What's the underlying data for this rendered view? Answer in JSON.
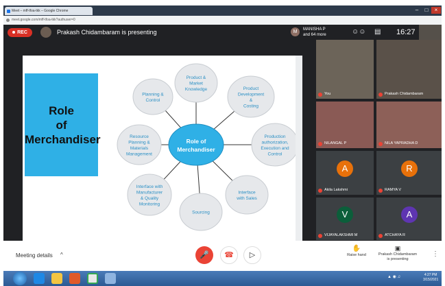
{
  "browser": {
    "tab_title": "Meet – mff-tfoa-tkk – Google Chrome",
    "address": "meet.google.com/mff-tfoa-tkk?authuser=0"
  },
  "topbar": {
    "rec_label": "REC",
    "presenting_text": "Prakash Chidambaram is presenting",
    "participants_name": "MANISHA P",
    "participants_more": "and 64 more",
    "time": "16:27"
  },
  "slide": {
    "title_lines": [
      "Role",
      "of",
      "Merchandiser"
    ],
    "center": [
      "Role of",
      "Merchandiser"
    ],
    "bubbles": [
      [
        "Product &",
        "Market",
        "Knowledge"
      ],
      [
        "Product",
        "Development",
        "&",
        "Costing"
      ],
      [
        "Production",
        "authorization,",
        "Execution and",
        "Control"
      ],
      [
        "Interface",
        "with Sales"
      ],
      [
        "Sourcing"
      ],
      [
        "Interface with",
        "Manufacturer",
        "& Quality",
        "Monitoring"
      ],
      [
        "Resource",
        "Planning &",
        "Materials",
        "Management"
      ],
      [
        "Planning &",
        "Control"
      ]
    ]
  },
  "participants": [
    {
      "name": "You",
      "type": "video"
    },
    {
      "name": "Prakash Chidambaram",
      "type": "video"
    },
    {
      "name": "NILANGAL P",
      "type": "video"
    },
    {
      "name": "NILA YAPRADHA D",
      "type": "video"
    },
    {
      "name": "Akila Lakshmi",
      "type": "avatar",
      "letter": "A",
      "color": "#e8710a"
    },
    {
      "name": "RAMYA V",
      "type": "avatar",
      "letter": "R",
      "color": "#e8710a"
    },
    {
      "name": "VIJAYALAKSHMI M",
      "type": "avatar",
      "letter": "V",
      "color": "#0b5e3a"
    },
    {
      "name": "ATCHAYA R",
      "type": "avatar",
      "letter": "A",
      "color": "#5e35b1"
    }
  ],
  "bottom": {
    "meeting_details": "Meeting details",
    "raise_hand": "Raise hand",
    "present_line1": "Prakash Chidambaram",
    "present_line2": "is presenting"
  },
  "taskbar": {
    "time": "4:27 PM",
    "date": "3/15/2021"
  },
  "colors": {
    "accent_blue": "#2fb0e6",
    "bubble_gray": "#e6e8eb",
    "mic_red": "#ea4335",
    "rec_red": "#d93025"
  }
}
